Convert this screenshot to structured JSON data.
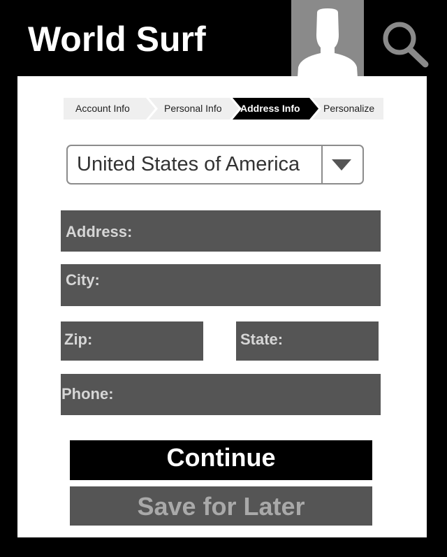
{
  "header": {
    "app_title": "World Surf",
    "avatar_icon": "user-avatar-icon",
    "search_icon": "search-icon"
  },
  "steps": [
    {
      "label": "Account Info",
      "active": false
    },
    {
      "label": "Personal Info",
      "active": false
    },
    {
      "label": "Address Info",
      "active": true
    },
    {
      "label": "Personalize",
      "active": false
    }
  ],
  "country_select": {
    "value": "United States of America",
    "arrow_icon": "dropdown-arrow-icon"
  },
  "fields": {
    "address": "Address:",
    "city": "City:",
    "zip": "Zip:",
    "state": "State:",
    "phone": "Phone:"
  },
  "buttons": {
    "continue": "Continue",
    "save_later": "Save for Later"
  },
  "colors": {
    "background": "#000000",
    "panel": "#ffffff",
    "field": "#555555",
    "step_inactive": "#efefef",
    "step_active": "#000000"
  }
}
